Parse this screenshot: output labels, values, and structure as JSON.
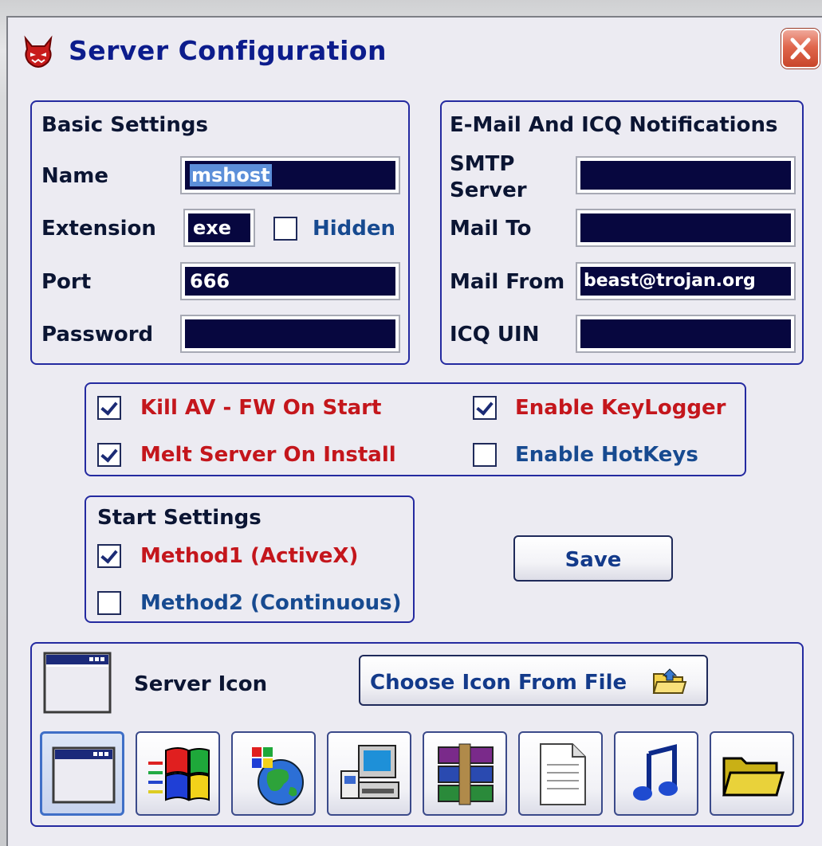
{
  "window": {
    "title": "Server Configuration"
  },
  "basic": {
    "heading": "Basic Settings",
    "name_label": "Name",
    "name_value": "mshost",
    "ext_label": "Extension",
    "ext_value": "exe",
    "hidden_label": "Hidden",
    "hidden_checked": false,
    "port_label": "Port",
    "port_value": "666",
    "password_label": "Password",
    "password_value": ""
  },
  "email": {
    "heading": "E-Mail And ICQ Notifications",
    "smtp_label_1": "SMTP",
    "smtp_label_2": "Server",
    "smtp_value": "",
    "mailto_label": "Mail To",
    "mailto_value": "",
    "mailfrom_label": "Mail From",
    "mailfrom_value": "beast@trojan.org",
    "icq_label": "ICQ UIN",
    "icq_value": ""
  },
  "options": {
    "kill_av": {
      "label": "Kill AV - FW On Start",
      "checked": true
    },
    "keylogger": {
      "label": "Enable KeyLogger",
      "checked": true
    },
    "melt": {
      "label": "Melt Server On Install",
      "checked": true
    },
    "hotkeys": {
      "label": "Enable HotKeys",
      "checked": false
    }
  },
  "start": {
    "heading": "Start Settings",
    "method1": {
      "label": "Method1 (ActiveX)",
      "checked": true
    },
    "method2": {
      "label": "Method2 (Continuous)",
      "checked": false
    }
  },
  "save_label": "Save",
  "icon": {
    "label": "Server Icon",
    "choose_label": "Choose Icon From File",
    "choices": [
      "window-icon",
      "windows-flag-icon",
      "globe-icon",
      "computer-icon",
      "winrar-icon",
      "document-icon",
      "music-note-icon",
      "folder-icon"
    ],
    "selected_index": 0
  },
  "colors": {
    "accent": "#242aa0",
    "label_red": "#c4161c",
    "label_blue": "#174a90",
    "field_bg": "#07073f"
  }
}
